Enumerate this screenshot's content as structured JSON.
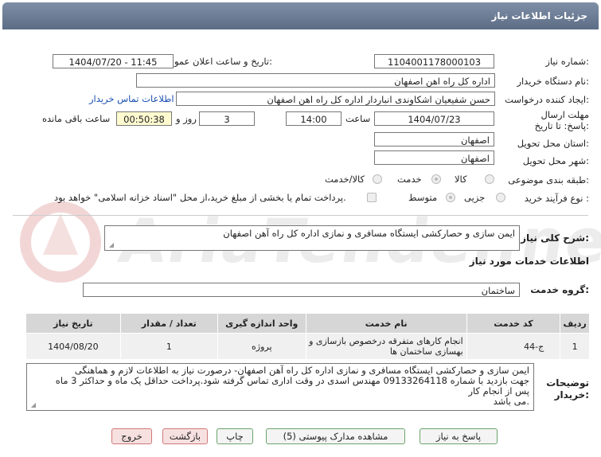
{
  "title": "جزئیات اطلاعات نیاز",
  "watermark": "AriaTender.net",
  "fields": {
    "need_number_label": "شماره نیاز:",
    "need_number": "1104001178000103",
    "announce_label": "تاریخ و ساعت اعلان عمومی:",
    "announce_value": "1404/07/20 - 11:45",
    "buyer_label": "نام دستگاه خریدار:",
    "buyer_value": "اداره کل راه اهن اصفهان",
    "creator_label": "ایجاد کننده درخواست:",
    "creator_value": "حسن شفیعیان اشکاوندی انباردار اداره کل راه اهن اصفهان",
    "contact_link": "اطلاعات تماس خریدار",
    "deadline_label": "مهلت ارسال پاسخ: تا تاریخ:",
    "deadline_date": "1404/07/23",
    "time_label": "ساعت",
    "deadline_time": "14:00",
    "days_value": "3",
    "days_label": "روز و",
    "remaining_value": "00:50:38",
    "remaining_label": "ساعت باقی مانده",
    "province_label": "استان محل تحویل:",
    "province_value": "اصفهان",
    "city_label": "شهر محل تحویل:",
    "city_value": "اصفهان",
    "category_label": "طبقه بندی موضوعی:",
    "category_options": [
      "کالا",
      "خدمت",
      "کالا/خدمت"
    ],
    "process_label": "نوع فرآیند خرید :",
    "process_options": [
      "جزیی",
      "متوسط"
    ],
    "payment_note": "پرداخت تمام یا بخشی از مبلغ خرید،از محل \"اسناد خزانه اسلامی\" خواهد بود."
  },
  "summary": {
    "label": "شرح کلی نیاز:",
    "value": "ایمن سازی و حصارکشی ایستگاه مسافری و نمازی اداره کل راه آهن اصفهان"
  },
  "services": {
    "section_label": "اطلاعات خدمات مورد نیاز",
    "group_label": "گروه خدمت:",
    "group_value": "ساختمان",
    "table": {
      "headers": [
        "ردیف",
        "کد خدمت",
        "نام خدمت",
        "واحد اندازه گیری",
        "تعداد / مقدار",
        "تاریخ نیاز"
      ],
      "rows": [
        {
          "row": "1",
          "code": "ج-44",
          "name": "انجام کارهای متفرقه درخصوص بازسازی و بهسازی ساختمان ها",
          "unit": "پروژه",
          "qty": "1",
          "date": "1404/08/20"
        }
      ]
    }
  },
  "buyer_notes": {
    "label": "توضیحات خریدار:",
    "lines": [
      "ایمن سازی و حصارکشی ایستگاه مسافری و نمازی اداره کل راه آهن اصفهان- درصورت نیاز به اطلاعات لازم و هماهنگی",
      "جهت بازدید با شماره 09133264118 مهندس اسدی در وقت اداری تماس گرفته شود.پرداخت حداقل یک ماه و حداکثر 3 ماه",
      "پس از انجام کار",
      "می باشد."
    ]
  },
  "buttons": {
    "reply": "پاسخ به نیاز",
    "attachments": "مشاهده مدارک پیوستی (5)",
    "print": "چاپ",
    "back": "بازگشت",
    "exit": "خروج"
  }
}
